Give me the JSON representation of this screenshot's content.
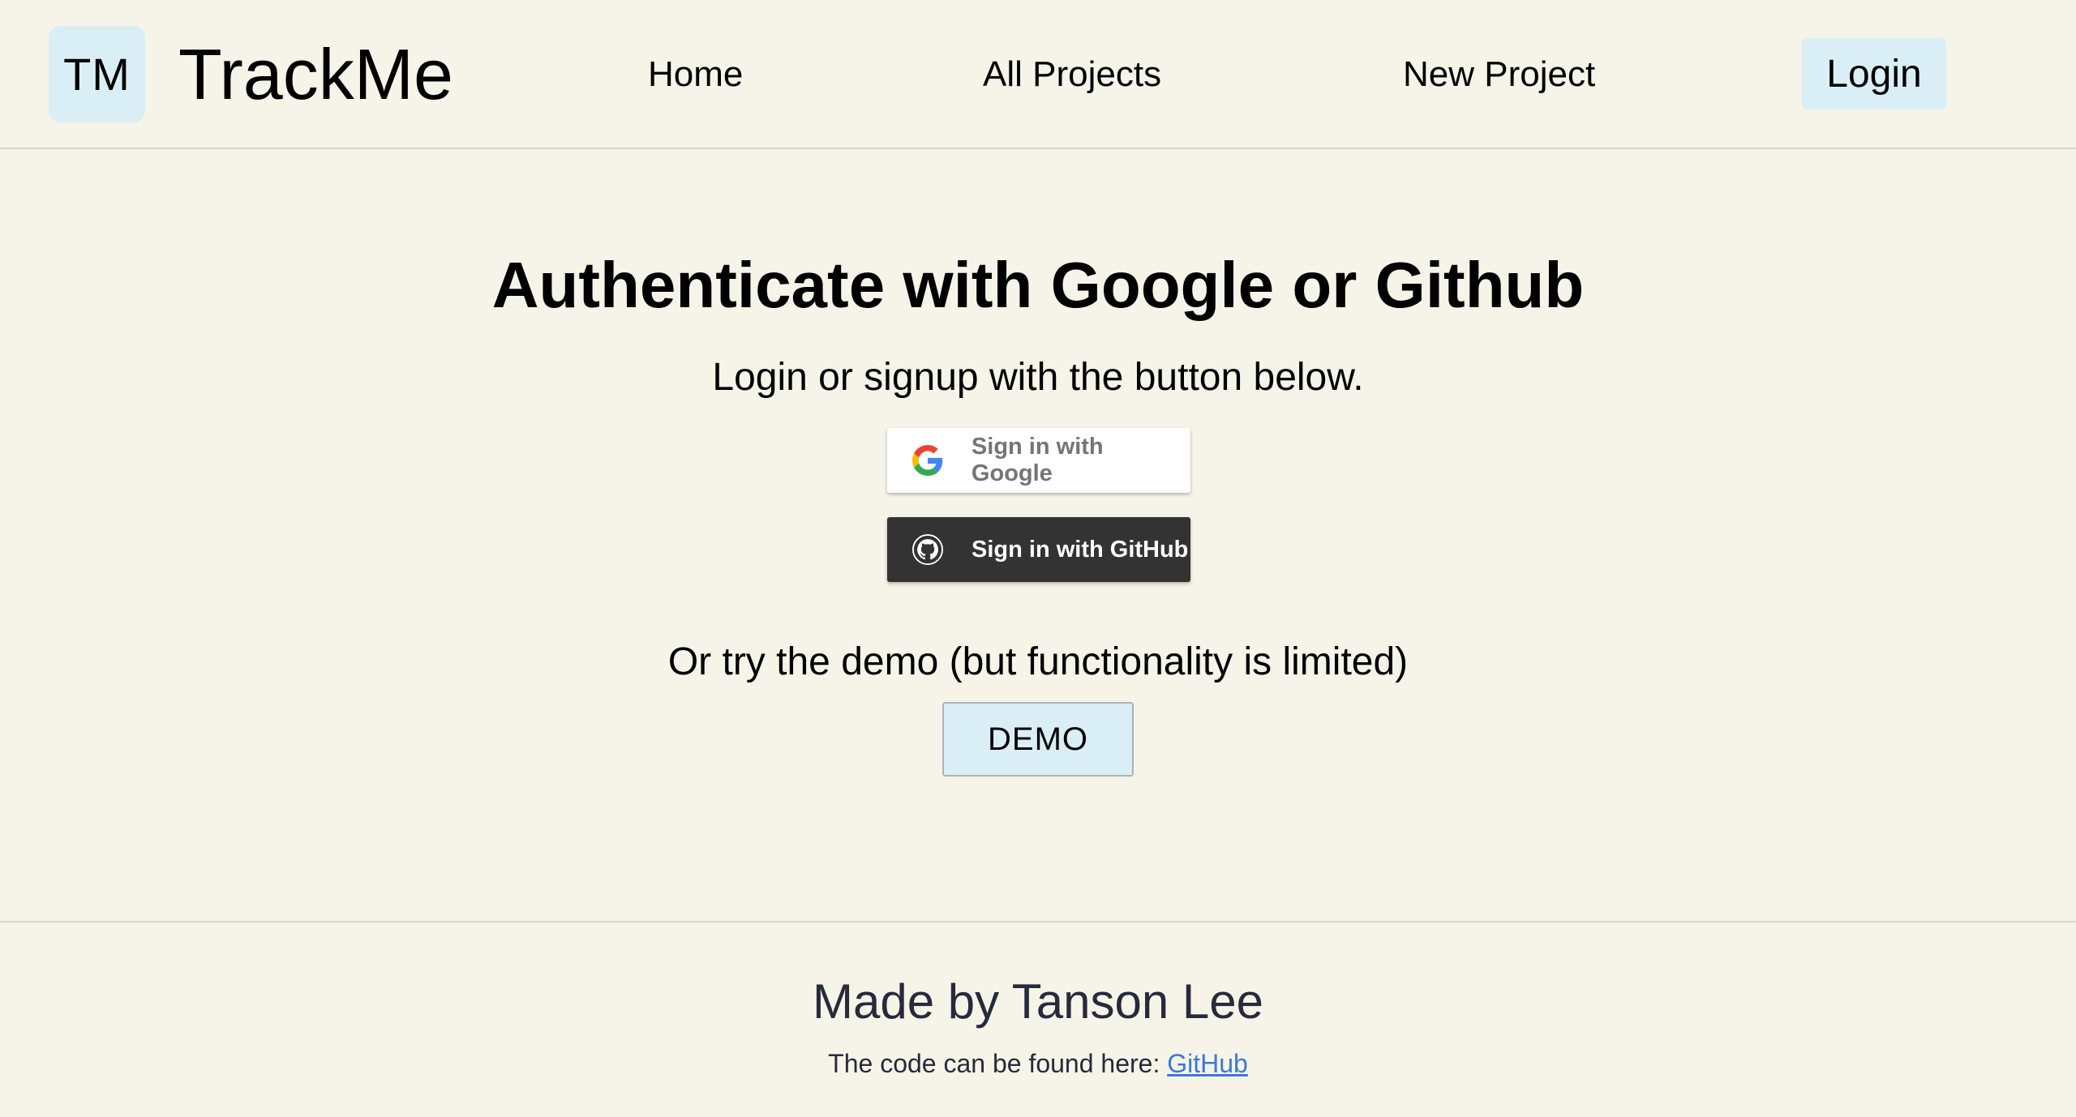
{
  "header": {
    "logo_text": "TM",
    "brand": "TrackMe",
    "nav": {
      "home": "Home",
      "all_projects": "All Projects",
      "new_project": "New Project"
    },
    "login_label": "Login"
  },
  "main": {
    "heading": "Authenticate with Google or Github",
    "subheading": "Login or signup with the button below.",
    "google_button": {
      "label": "Sign in with Google",
      "icon": "google-icon"
    },
    "github_button": {
      "label": "Sign in with GitHub",
      "icon": "github-icon"
    },
    "demo_text": "Or try the demo (but functionality is limited)",
    "demo_label": "DEMO"
  },
  "footer": {
    "title": "Made by Tanson Lee",
    "note_prefix": "The code can be found here: ",
    "link_label": "GitHub"
  },
  "colors": {
    "background": "#f6f4e8",
    "accent": "#daeff5",
    "github_button": "#333333",
    "link": "#3c78d8",
    "footer_text": "#262a3b"
  }
}
